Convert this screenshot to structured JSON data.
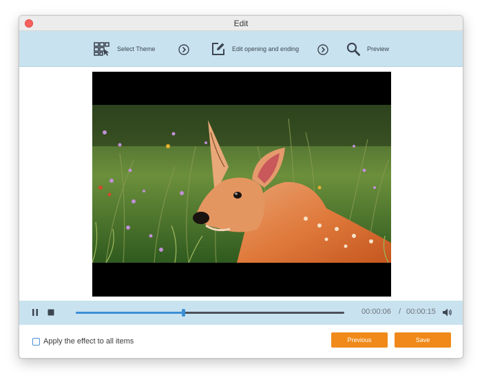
{
  "window": {
    "title": "Edit"
  },
  "steps": [
    {
      "label": "Select Theme",
      "icon": "theme-grid-icon"
    },
    {
      "label": "Edit opening and ending",
      "icon": "edit-icon"
    },
    {
      "label": "Preview",
      "icon": "search-icon"
    }
  ],
  "player": {
    "current_time": "00:00:06",
    "separator": "/",
    "total_time": "00:00:15",
    "progress": 0.4
  },
  "footer": {
    "apply_all_label": "Apply the effect to all items",
    "apply_all_checked": false,
    "previous_label": "Previous",
    "save_label": "Save"
  },
  "colors": {
    "accent": "#f0891a",
    "toolbar_bg": "#c9e2f0",
    "progress": "#3b8fd6"
  }
}
